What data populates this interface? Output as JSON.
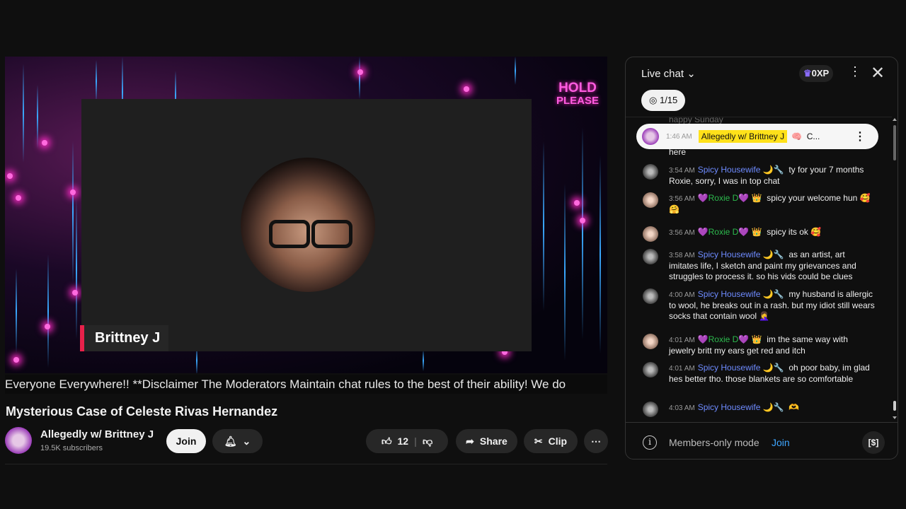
{
  "video": {
    "overlay_name": "Brittney J",
    "hold_line1": "HOLD",
    "hold_line2": "PLEASE",
    "ticker": "Everyone Everywhere!! **Disclaimer The Moderators Maintain chat rules to the best of their ability! We do"
  },
  "title": "Mysterious Case of Celeste Rivas Hernandez",
  "channel": {
    "name": "Allegedly w/ Brittney J",
    "subscribers": "19.5K subscribers",
    "join": "Join"
  },
  "actions": {
    "likes": "12",
    "share": "Share",
    "clip": "Clip"
  },
  "chat": {
    "title": "Live chat",
    "xp": "0XP",
    "goal": "1/15",
    "pinned": {
      "time": "1:46 AM",
      "author": "Allegedly w/ Brittney J",
      "text": "C..."
    },
    "partial_top": "happy Sunday",
    "partial_here": "here",
    "messages": [
      {
        "time": "3:54 AM",
        "author": "Spicy Housewife",
        "badges": "🌙🔧",
        "text": "ty for your 7 months Roxie, sorry, I was in top chat"
      },
      {
        "time": "3:56 AM",
        "author": "💜Roxie D💜",
        "badges": "👑",
        "text": "spicy your welcome hun 🥰🤗"
      },
      {
        "time": "3:56 AM",
        "author": "💜Roxie D💜",
        "badges": "👑",
        "text": "spicy its ok 🥰"
      },
      {
        "time": "3:58 AM",
        "author": "Spicy Housewife",
        "badges": "🌙🔧",
        "text": "as an artist, art imitates life, I sketch and paint my grievances and struggles to process it. so his vids could be clues"
      },
      {
        "time": "4:00 AM",
        "author": "Spicy Housewife",
        "badges": "🌙🔧",
        "text": "my husband is allergic to wool, he breaks out in a rash. but my idiot still wears socks that contain wool 🤦‍♀️"
      },
      {
        "time": "4:01 AM",
        "author": "💜Roxie D💜",
        "badges": "👑",
        "text": "im the same way with jewelry britt my ears get red and itch"
      },
      {
        "time": "4:01 AM",
        "author": "Spicy Housewife",
        "badges": "🌙🔧",
        "text": "oh poor baby, im glad hes better tho. those blankets are so comfortable"
      },
      {
        "time": "4:03 AM",
        "author": "Spicy Housewife",
        "badges": "🌙🔧",
        "text": "🫶"
      }
    ],
    "footer": {
      "mode": "Members-only mode",
      "join": "Join"
    }
  }
}
